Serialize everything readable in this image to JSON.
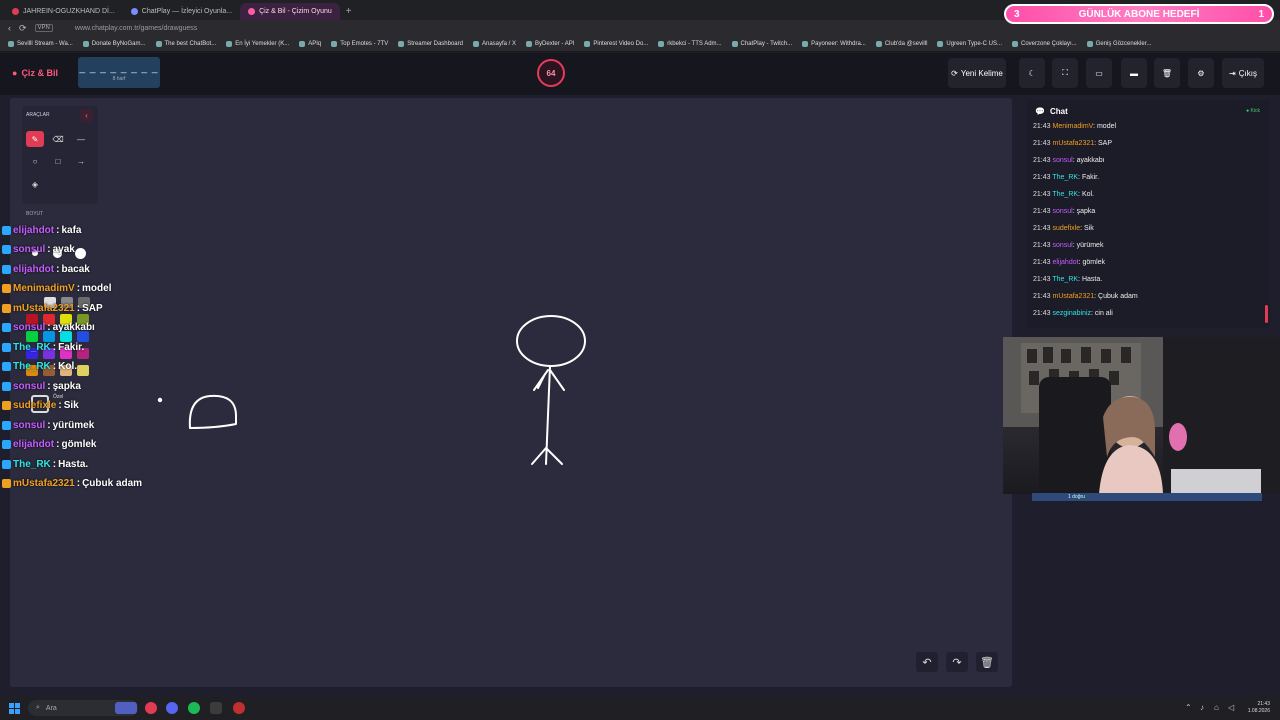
{
  "browser": {
    "tabs": [
      {
        "label": "JAHREIN-OGUZKHAND Dİ..."
      },
      {
        "label": "ChatPlay — İzleyici Oyunla..."
      },
      {
        "label": "Çiz & Bil - Çizim Oyunu"
      }
    ],
    "new_tab": "+",
    "url": "www.chatplay.com.tr/games/drawguess",
    "vpn": "VPN",
    "bookmarks": [
      "Sevilll Stream - Wa...",
      "Donate ByNoGam...",
      "The best ChatBot...",
      "En İyi Yemekler (K...",
      "APIq",
      "Top Emotes - 7TV",
      "Streamer Dashboard",
      "Anasayfa / X",
      "ByDexter - API",
      "Pinterest Video Do...",
      "rkbekci - TTS Adm...",
      "ChatPlay - Twitch...",
      "Payoneer: Withdra...",
      "Club'da @sevilll",
      "Ugreen Type-C US...",
      "Coverzone Çoklayı...",
      "Geniş Gözcenekler..."
    ]
  },
  "goal": {
    "left_count": "3",
    "label": "GÜNLÜK ABONE HEDEFİ",
    "right_count": "1"
  },
  "header": {
    "logo": "Çiz & Bil",
    "word_mask": "_ _ _ _ _ _ _ _",
    "word_length": "8 harf",
    "timer": "64",
    "new_word": "Yeni Kelime",
    "exit": "Çıkış"
  },
  "tools": {
    "title": "ARAÇLAR",
    "size_label": "BOYUT",
    "custom_label": "Özel"
  },
  "overlay_chat": [
    {
      "user": "elijahdot",
      "msg": "kafa",
      "color": "#c45cff"
    },
    {
      "user": "sonsul",
      "msg": "ayak",
      "color": "#c45cff"
    },
    {
      "user": "elijahdot",
      "msg": "bacak",
      "color": "#c45cff"
    },
    {
      "user": "MenimadimV",
      "msg": "model",
      "color": "#f0a020"
    },
    {
      "user": "mUstafa2321",
      "msg": "SAP",
      "color": "#f0a020"
    },
    {
      "user": "sonsul",
      "msg": "ayakkabı",
      "color": "#c45cff"
    },
    {
      "user": "The_RK",
      "msg": "Fakir.",
      "color": "#2ee6e6"
    },
    {
      "user": "The_RK",
      "msg": "Kol.",
      "color": "#2ee6e6"
    },
    {
      "user": "sonsul",
      "msg": "şapka",
      "color": "#c45cff"
    },
    {
      "user": "sudefixle",
      "msg": "Sik",
      "color": "#f0a020"
    },
    {
      "user": "sonsul",
      "msg": "yürümek",
      "color": "#c45cff"
    },
    {
      "user": "elijahdot",
      "msg": "gömlek",
      "color": "#c45cff"
    },
    {
      "user": "The_RK",
      "msg": "Hasta.",
      "color": "#2ee6e6"
    },
    {
      "user": "mUstafa2321",
      "msg": "Çubuk adam",
      "color": "#f0a020"
    }
  ],
  "chat": {
    "title": "Chat",
    "platform": "Kick",
    "messages": [
      {
        "time": "21:43",
        "user": "MenimadimV",
        "msg": "model",
        "color": "#f0a020"
      },
      {
        "time": "21:43",
        "user": "mUstafa2321",
        "msg": "SAP",
        "color": "#f0a020"
      },
      {
        "time": "21:43",
        "user": "sonsul",
        "msg": "ayakkabı",
        "color": "#c45cff"
      },
      {
        "time": "21:43",
        "user": "The_RK",
        "msg": "Fakir.",
        "color": "#2ee6e6"
      },
      {
        "time": "21:43",
        "user": "The_RK",
        "msg": "Kol.",
        "color": "#2ee6e6"
      },
      {
        "time": "21:43",
        "user": "sonsul",
        "msg": "şapka",
        "color": "#c45cff"
      },
      {
        "time": "21:43",
        "user": "sudefixle",
        "msg": "Sik",
        "color": "#f0a020"
      },
      {
        "time": "21:43",
        "user": "sonsul",
        "msg": "yürümek",
        "color": "#c45cff"
      },
      {
        "time": "21:43",
        "user": "elijahdot",
        "msg": "gömlek",
        "color": "#c45cff"
      },
      {
        "time": "21:43",
        "user": "The_RK",
        "msg": "Hasta.",
        "color": "#2ee6e6"
      },
      {
        "time": "21:43",
        "user": "mUstafa2321",
        "msg": "Çubuk adam",
        "color": "#f0a020"
      },
      {
        "time": "21:43",
        "user": "sezginabiniz",
        "msg": "cin ali",
        "color": "#2ee6e6"
      }
    ]
  },
  "webcam": {
    "label": "1 doğru"
  },
  "taskbar": {
    "search_placeholder": "Ara",
    "time": "21:43",
    "date": "1.08.2026"
  }
}
